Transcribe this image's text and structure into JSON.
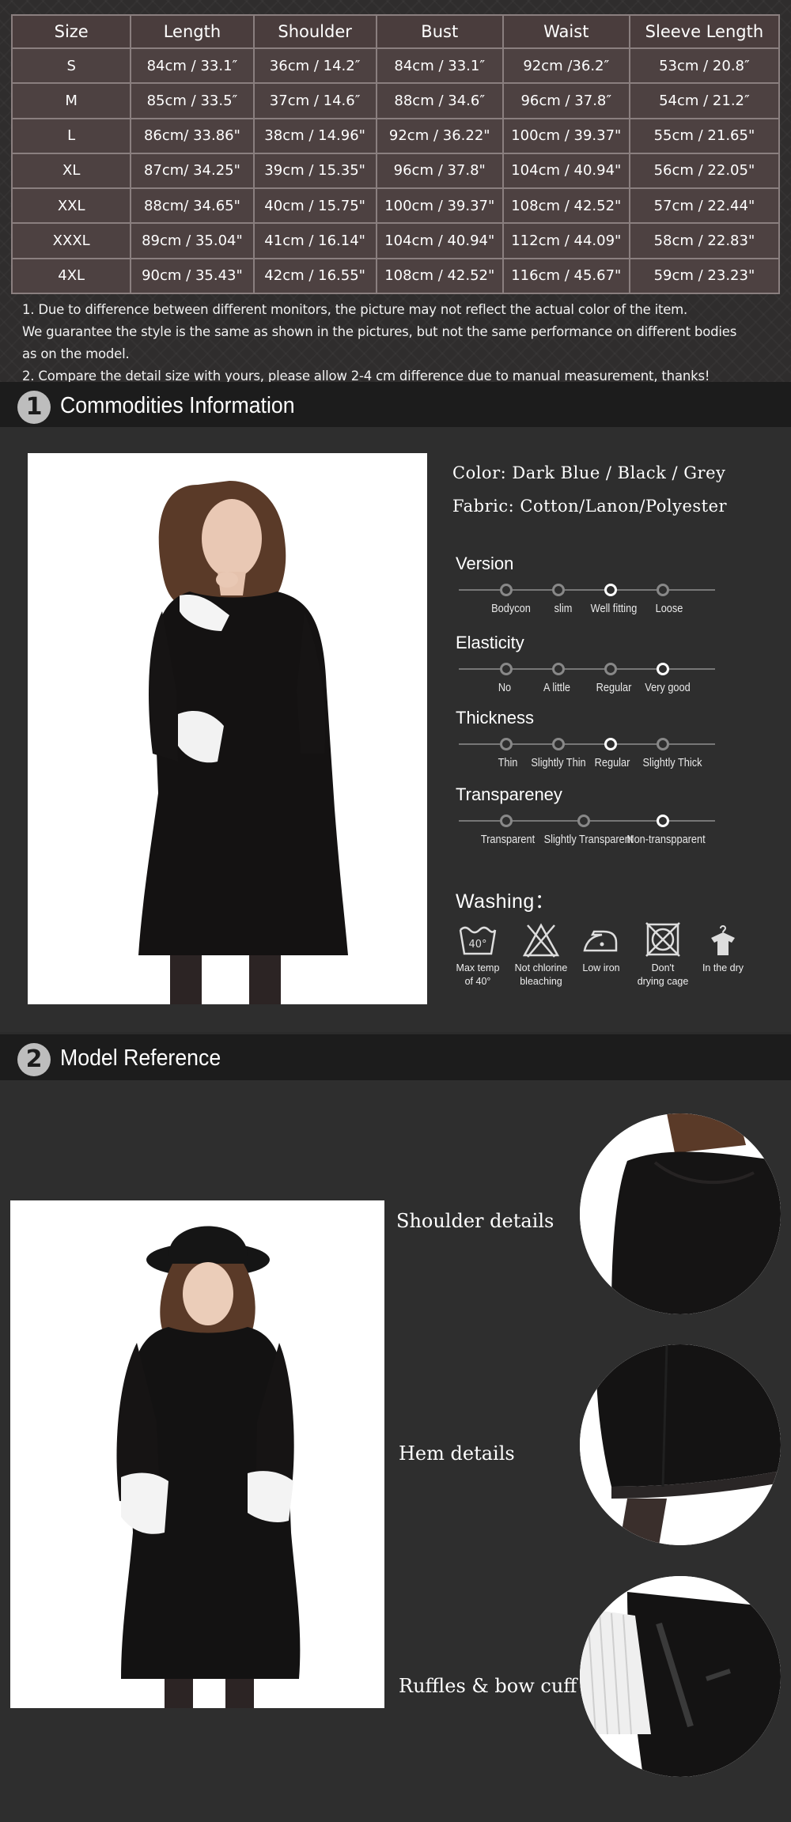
{
  "size_table": {
    "headers": [
      "Size",
      "Length",
      "Shoulder",
      "Bust",
      "Waist",
      "Sleeve  Length"
    ],
    "rows": [
      [
        "S",
        "84cm / 33.1″",
        "36cm / 14.2″",
        "84cm / 33.1″",
        "92cm /36.2″",
        "53cm / 20.8″"
      ],
      [
        "M",
        "85cm / 33.5″",
        "37cm / 14.6″",
        "88cm / 34.6″",
        "96cm / 37.8″",
        "54cm / 21.2″"
      ],
      [
        "L",
        "86cm/ 33.86\"",
        "38cm / 14.96\"",
        "92cm / 36.22\"",
        "100cm / 39.37\"",
        "55cm / 21.65\""
      ],
      [
        "XL",
        "87cm/ 34.25\"",
        "39cm / 15.35\"",
        "96cm / 37.8\"",
        "104cm / 40.94\"",
        "56cm / 22.05\""
      ],
      [
        "XXL",
        "88cm/ 34.65\"",
        "40cm / 15.75\"",
        "100cm / 39.37\"",
        "108cm / 42.52\"",
        "57cm / 22.44\""
      ],
      [
        "XXXL",
        "89cm / 35.04\"",
        "41cm / 16.14\"",
        "104cm / 40.94\"",
        "112cm / 44.09\"",
        "58cm / 22.83\""
      ],
      [
        "4XL",
        "90cm / 35.43\"",
        "42cm / 16.55\"",
        "108cm / 42.52\"",
        "116cm / 45.67\"",
        "59cm / 23.23\""
      ]
    ],
    "notes": [
      "1. Due to difference between different monitors, the picture may not reflect the actual color of the item.",
      " We guarantee the style is the same as shown in the pictures, but not the same performance on different bodies",
      " as on the model.",
      "2. Compare the detail size with yours, please allow 2-4 cm difference due to manual measurement, thanks!"
    ]
  },
  "section1": {
    "number": "1",
    "title": "Commodities Information"
  },
  "section2": {
    "number": "2",
    "title": "Model Reference"
  },
  "info": {
    "color": "Color: Dark Blue / Black / Grey",
    "fabric": "Fabric: Cotton/Lanon/Polyester"
  },
  "attributes": [
    {
      "title": "Version",
      "options": [
        "Bodycon",
        "slim",
        "Well fitting",
        "Loose"
      ],
      "selected_index": 2
    },
    {
      "title": "Elasticity",
      "options": [
        "No",
        "A little",
        "Regular",
        "Very good"
      ],
      "selected_index": 3
    },
    {
      "title": "Thickness",
      "options": [
        "Thin",
        "Slightly Thin",
        "Regular",
        "Slightly Thick"
      ],
      "selected_index": 2
    },
    {
      "title": "Transpareney",
      "options": [
        "Transparent",
        "Slightly Transparent",
        "Non-transpparent"
      ],
      "selected_index": 2
    }
  ],
  "washing": {
    "title": "Washing：",
    "temp_mark": "40°",
    "items": [
      {
        "icon": "wash-40-icon",
        "label1": "Max temp",
        "label2": "of  40°"
      },
      {
        "icon": "no-bleach-icon",
        "label1": "Not chlorine",
        "label2": "bleaching"
      },
      {
        "icon": "low-iron-icon",
        "label1": "Low iron",
        "label2": ""
      },
      {
        "icon": "no-tumble-dry-icon",
        "label1": "Don't",
        "label2": "drying cage"
      },
      {
        "icon": "dry-hang-icon",
        "label1": "In the dry",
        "label2": ""
      }
    ]
  },
  "details": {
    "shoulder": "Shoulder details",
    "hem": "Hem details",
    "ruffles": "Ruffles & bow cuff"
  },
  "colors": {
    "header_bg": "#1c1c1c",
    "body_bg": "#2e2e2e",
    "table_bg": "#4d4141",
    "selected_dot": "#ffffff",
    "dot": "#888888"
  }
}
